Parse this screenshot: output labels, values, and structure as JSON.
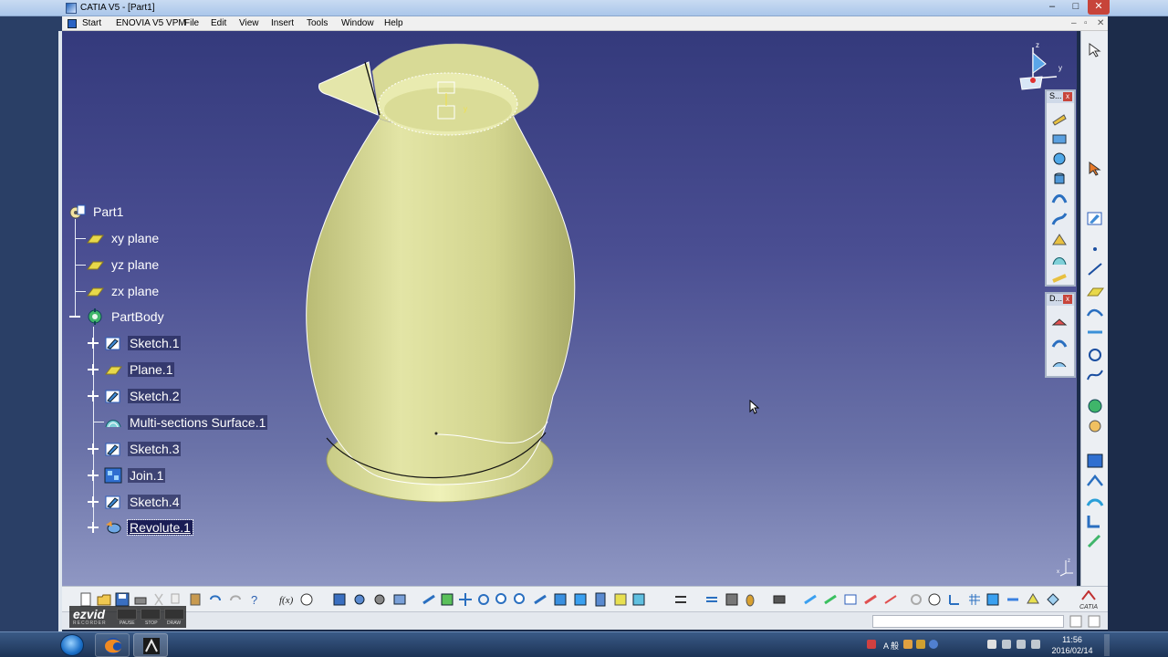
{
  "window": {
    "title": "CATIA V5 - [Part1]",
    "controls": [
      "–",
      "□",
      "✕"
    ]
  },
  "menu": {
    "items": [
      "Start",
      "ENOVIA V5 VPM",
      "File",
      "Edit",
      "View",
      "Insert",
      "Tools",
      "Window",
      "Help"
    ],
    "mdi_controls": [
      "–",
      "▫",
      "✕"
    ]
  },
  "tree": {
    "root": "Part1",
    "planes": [
      "xy plane",
      "yz plane",
      "zx plane"
    ],
    "body": "PartBody",
    "features": [
      {
        "label": "Sketch.1",
        "icon": "sketch-icon"
      },
      {
        "label": "Plane.1",
        "icon": "plane-icon"
      },
      {
        "label": "Sketch.2",
        "icon": "sketch-icon"
      },
      {
        "label": "Multi-sections Surface.1",
        "icon": "multi-sections-surface-icon"
      },
      {
        "label": "Sketch.3",
        "icon": "sketch-icon"
      },
      {
        "label": "Join.1",
        "icon": "join-icon"
      },
      {
        "label": "Sketch.4",
        "icon": "sketch-icon"
      },
      {
        "label": "Revolute.1",
        "icon": "revolute-icon"
      }
    ],
    "selected": "Revolute.1"
  },
  "float_toolbars": {
    "surfaces": {
      "title": "S..."
    },
    "draft": {
      "title": "D..."
    }
  },
  "compass_axes": {
    "z": "z",
    "y": "y"
  },
  "corner_axis": {
    "z": "z",
    "x": "x"
  },
  "ezvid": {
    "logo": "ezvid",
    "sub": "RECORDER",
    "buttons": [
      "PAUSE",
      "STOP",
      "DRAW"
    ]
  },
  "brand": "CATIA",
  "taskbar": {
    "time": "11:56",
    "date": "2016/02/14",
    "lang": "A 般"
  },
  "colors": {
    "viewport_top": "#343a7c",
    "viewport_bottom": "#8f97c3",
    "model_fill": "#d9dc9c",
    "tree_text": "#ffffff"
  }
}
